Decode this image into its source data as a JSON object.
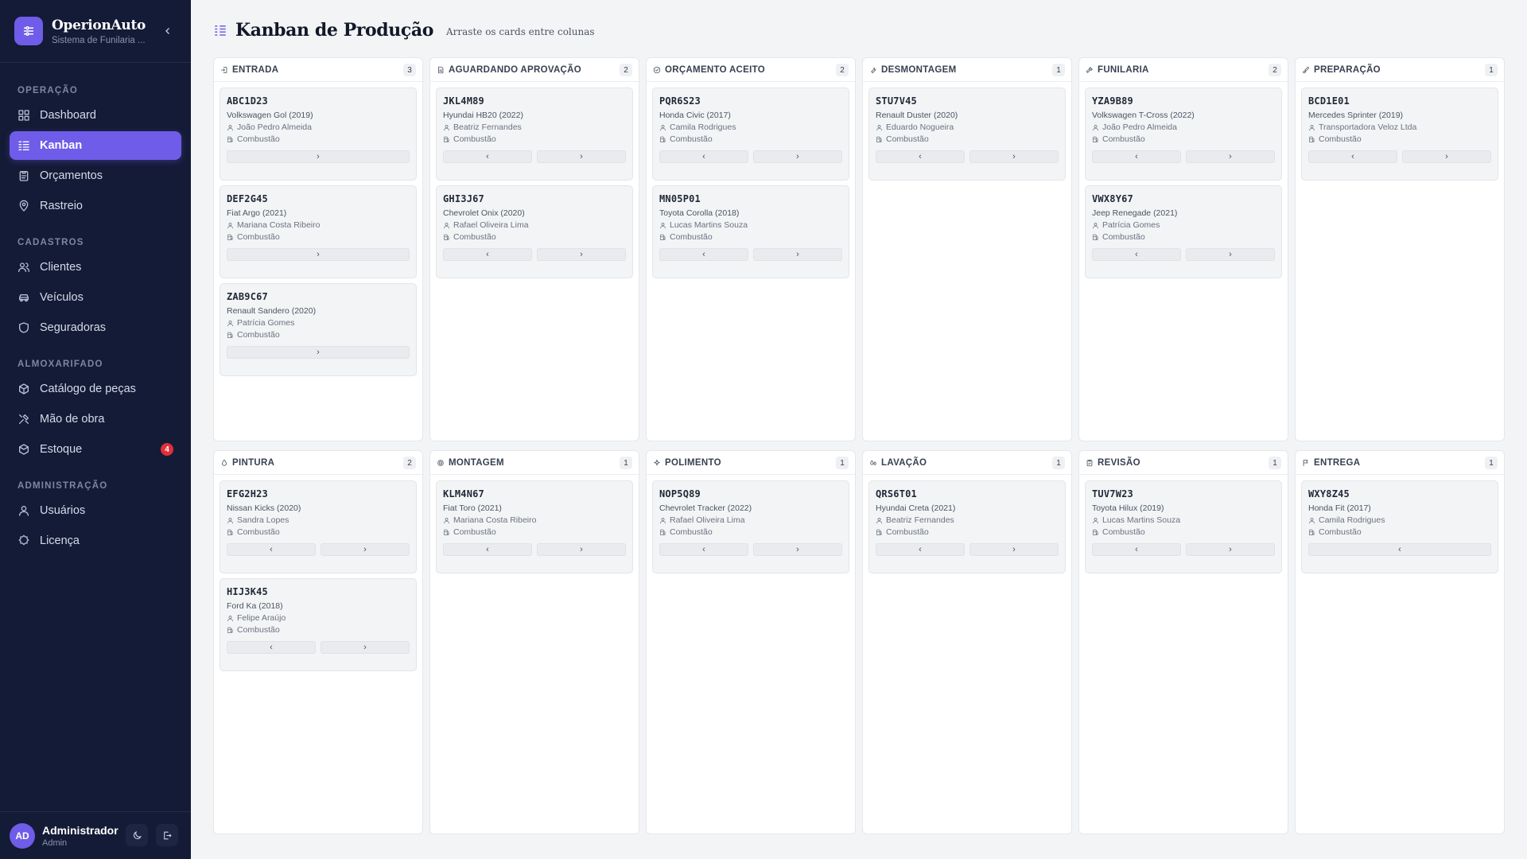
{
  "app": {
    "name": "OperionAuto",
    "subtitle": "Sistema de Funilaria ...",
    "accent": "#6f5ce8",
    "sidebar_bg": "#141b36"
  },
  "sidebar": {
    "sections": [
      {
        "label": "OPERAÇÃO",
        "items": [
          {
            "label": "Dashboard",
            "icon": "dashboard-icon",
            "active": false
          },
          {
            "label": "Kanban",
            "icon": "kanban-icon",
            "active": true
          },
          {
            "label": "Orçamentos",
            "icon": "clipboard-icon",
            "active": false
          },
          {
            "label": "Rastreio",
            "icon": "map-pin-icon",
            "active": false
          }
        ]
      },
      {
        "label": "CADASTROS",
        "items": [
          {
            "label": "Clientes",
            "icon": "users-icon",
            "active": false
          },
          {
            "label": "Veículos",
            "icon": "car-icon",
            "active": false
          },
          {
            "label": "Seguradoras",
            "icon": "shield-icon",
            "active": false
          }
        ]
      },
      {
        "label": "ALMOXARIFADO",
        "items": [
          {
            "label": "Catálogo de peças",
            "icon": "package-icon",
            "active": false
          },
          {
            "label": "Mão de obra",
            "icon": "tools-icon",
            "active": false
          },
          {
            "label": "Estoque",
            "icon": "boxes-icon",
            "active": false,
            "badge": "4"
          }
        ]
      },
      {
        "label": "ADMINISTRAÇÃO",
        "items": [
          {
            "label": "Usuários",
            "icon": "user-icon",
            "active": false
          },
          {
            "label": "Licença",
            "icon": "badge-icon",
            "active": false
          }
        ]
      }
    ]
  },
  "user": {
    "initials": "AD",
    "name": "Administrador",
    "role": "Admin"
  },
  "header": {
    "title": "Kanban de Produção",
    "subtitle": "Arraste os cards entre colunas"
  },
  "columns": [
    {
      "title": "ENTRADA",
      "count": "3",
      "icon": "login-icon",
      "cards": [
        {
          "plate": "ABC1D23",
          "vehicle": "Volkswagen Gol (2019)",
          "client": "João Pedro Almeida",
          "fuel": "Combustão",
          "prev": false,
          "next": true
        },
        {
          "plate": "DEF2G45",
          "vehicle": "Fiat Argo (2021)",
          "client": "Mariana Costa Ribeiro",
          "fuel": "Combustão",
          "prev": false,
          "next": true
        },
        {
          "plate": "ZAB9C67",
          "vehicle": "Renault Sandero (2020)",
          "client": "Patrícia Gomes",
          "fuel": "Combustão",
          "prev": false,
          "next": true
        }
      ]
    },
    {
      "title": "AGUARDANDO APROVAÇÃO",
      "count": "2",
      "icon": "document-icon",
      "cards": [
        {
          "plate": "JKL4M89",
          "vehicle": "Hyundai HB20 (2022)",
          "client": "Beatriz Fernandes",
          "fuel": "Combustão",
          "prev": true,
          "next": true
        },
        {
          "plate": "GHI3J67",
          "vehicle": "Chevrolet Onix (2020)",
          "client": "Rafael Oliveira Lima",
          "fuel": "Combustão",
          "prev": true,
          "next": true
        }
      ]
    },
    {
      "title": "ORÇAMENTO ACEITO",
      "count": "2",
      "icon": "check-circle-icon",
      "cards": [
        {
          "plate": "PQR6S23",
          "vehicle": "Honda Civic (2017)",
          "client": "Camila Rodrigues",
          "fuel": "Combustão",
          "prev": true,
          "next": true
        },
        {
          "plate": "MN05P01",
          "vehicle": "Toyota Corolla (2018)",
          "client": "Lucas Martins Souza",
          "fuel": "Combustão",
          "prev": true,
          "next": true
        }
      ]
    },
    {
      "title": "DESMONTAGEM",
      "count": "1",
      "icon": "wrench-icon",
      "cards": [
        {
          "plate": "STU7V45",
          "vehicle": "Renault Duster (2020)",
          "client": "Eduardo Nogueira",
          "fuel": "Combustão",
          "prev": true,
          "next": true
        }
      ]
    },
    {
      "title": "FUNILARIA",
      "count": "2",
      "icon": "hammer-icon",
      "cards": [
        {
          "plate": "YZA9B89",
          "vehicle": "Volkswagen T-Cross (2022)",
          "client": "João Pedro Almeida",
          "fuel": "Combustão",
          "prev": true,
          "next": true
        },
        {
          "plate": "VWX8Y67",
          "vehicle": "Jeep Renegade (2021)",
          "client": "Patrícia Gomes",
          "fuel": "Combustão",
          "prev": true,
          "next": true
        }
      ]
    },
    {
      "title": "PREPARAÇÃO",
      "count": "1",
      "icon": "brush-icon",
      "cards": [
        {
          "plate": "BCD1E01",
          "vehicle": "Mercedes Sprinter (2019)",
          "client": "Transportadora Veloz Ltda",
          "fuel": "Combustão",
          "prev": true,
          "next": true
        }
      ]
    },
    {
      "title": "PINTURA",
      "count": "2",
      "icon": "droplet-icon",
      "cards": [
        {
          "plate": "EFG2H23",
          "vehicle": "Nissan Kicks (2020)",
          "client": "Sandra Lopes",
          "fuel": "Combustão",
          "prev": true,
          "next": true
        },
        {
          "plate": "HIJ3K45",
          "vehicle": "Ford Ka (2018)",
          "client": "Felipe Araújo",
          "fuel": "Combustão",
          "prev": true,
          "next": true
        }
      ]
    },
    {
      "title": "MONTAGEM",
      "count": "1",
      "icon": "gear-icon",
      "cards": [
        {
          "plate": "KLM4N67",
          "vehicle": "Fiat Toro (2021)",
          "client": "Mariana Costa Ribeiro",
          "fuel": "Combustão",
          "prev": true,
          "next": true
        }
      ]
    },
    {
      "title": "POLIMENTO",
      "count": "1",
      "icon": "sparkle-icon",
      "cards": [
        {
          "plate": "NOP5Q89",
          "vehicle": "Chevrolet Tracker (2022)",
          "client": "Rafael Oliveira Lima",
          "fuel": "Combustão",
          "prev": true,
          "next": true
        }
      ]
    },
    {
      "title": "LAVAÇÃO",
      "count": "1",
      "icon": "drops-icon",
      "cards": [
        {
          "plate": "QRS6T01",
          "vehicle": "Hyundai Creta (2021)",
          "client": "Beatriz Fernandes",
          "fuel": "Combustão",
          "prev": true,
          "next": true
        }
      ]
    },
    {
      "title": "REVISÃO",
      "count": "1",
      "icon": "clipboard-check-icon",
      "cards": [
        {
          "plate": "TUV7W23",
          "vehicle": "Toyota Hilux (2019)",
          "client": "Lucas Martins Souza",
          "fuel": "Combustão",
          "prev": true,
          "next": true
        }
      ]
    },
    {
      "title": "ENTREGA",
      "count": "1",
      "icon": "flag-icon",
      "cards": [
        {
          "plate": "WXY8Z45",
          "vehicle": "Honda Fit (2017)",
          "client": "Camila Rodrigues",
          "fuel": "Combustão",
          "prev": true,
          "next": false
        }
      ]
    }
  ]
}
